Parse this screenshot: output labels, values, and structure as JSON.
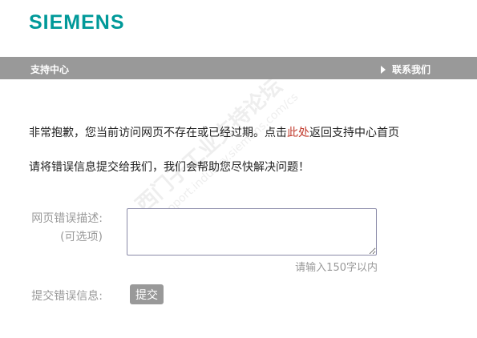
{
  "header": {
    "logo_text": "SIEMENS"
  },
  "nav": {
    "home_label": "支持中心",
    "contact_label": "联系我们"
  },
  "message": {
    "line1_before": "非常抱歉，您当前访问网页不存在或已经过期。点击",
    "line1_link": "此处",
    "line1_after": "返回支持中心首页",
    "line2": "请将错误信息提交给我们，我们会帮助您尽快解决问题！"
  },
  "form": {
    "desc_label": "网页错误描述:",
    "desc_optional": "(可选项)",
    "desc_value": "",
    "hint": "请输入150字以内",
    "submit_label_text": "提交错误信息:",
    "submit_button": "提交"
  },
  "watermark": {
    "line1": "西门子工业支持论坛",
    "line2": "support.industry.siemens.com/cs"
  },
  "colors": {
    "brand": "#009999",
    "navbar": "#999999",
    "link": "#c0392b",
    "muted_text": "#999999"
  }
}
